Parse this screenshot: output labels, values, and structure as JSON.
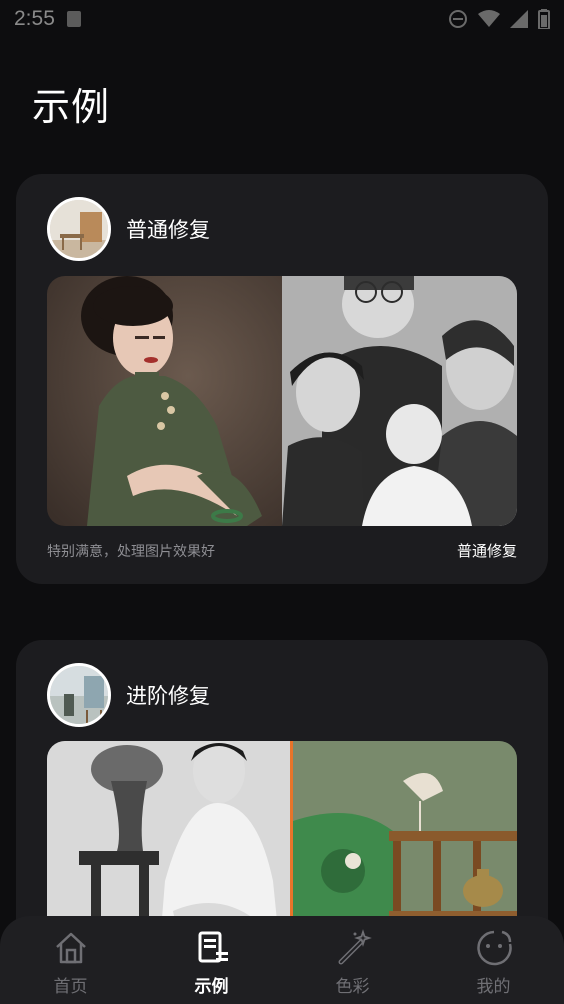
{
  "status_bar": {
    "time": "2:55"
  },
  "page": {
    "title": "示例"
  },
  "cards": [
    {
      "title": "普通修复",
      "review": "特别满意，处理图片效果好",
      "tag": "普通修复"
    },
    {
      "title": "进阶修复"
    }
  ],
  "nav": {
    "items": [
      {
        "label": "首页",
        "icon": "home-icon"
      },
      {
        "label": "示例",
        "icon": "document-list-icon",
        "active": true
      },
      {
        "label": "色彩",
        "icon": "magic-wand-icon"
      },
      {
        "label": "我的",
        "icon": "smiley-face-icon"
      }
    ]
  },
  "colors": {
    "background": "#0d0d0f",
    "card": "#1c1c1f",
    "nav": "#1f1f22",
    "muted": "#8e8e93",
    "divider_accent": "#e8742a"
  }
}
